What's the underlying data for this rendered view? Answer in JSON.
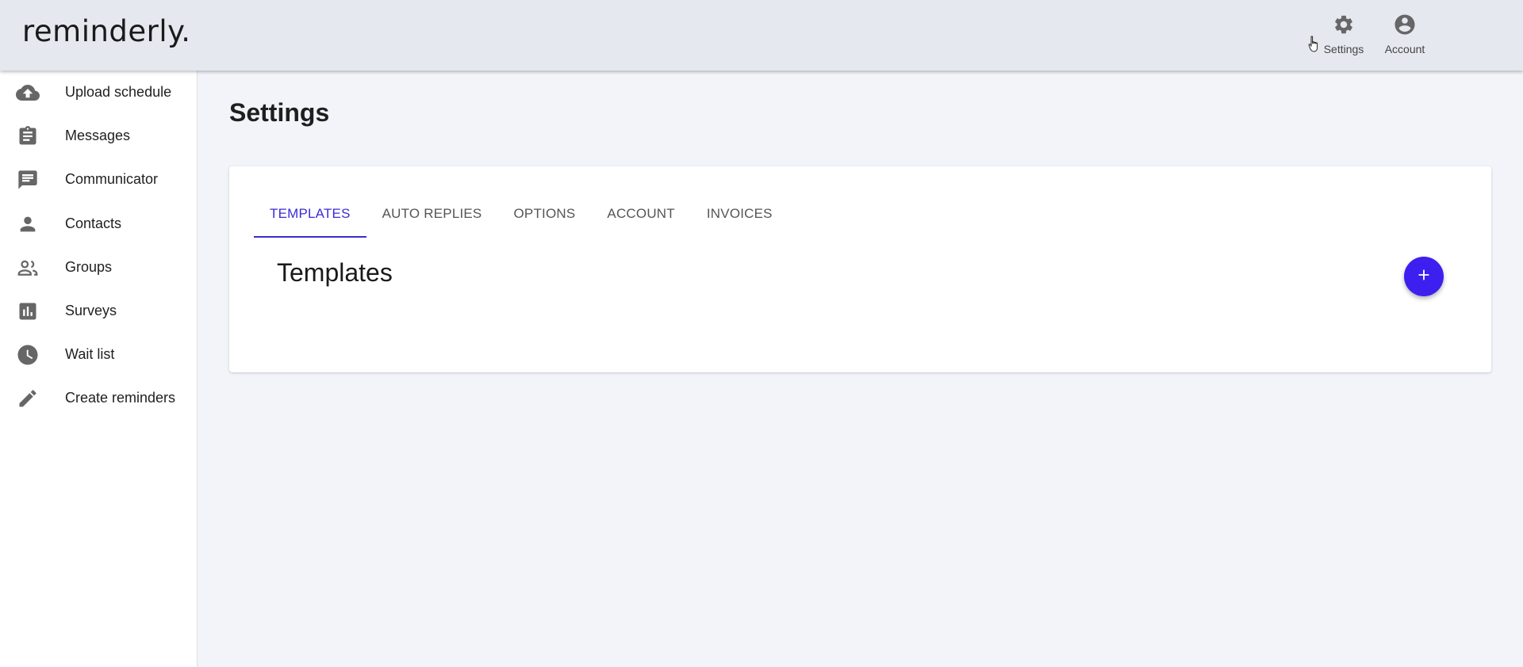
{
  "app": {
    "logo": "reminderly."
  },
  "header": {
    "actions": [
      {
        "label": "Settings",
        "icon": "gear-icon"
      },
      {
        "label": "Account",
        "icon": "account-circle-icon"
      }
    ]
  },
  "sidebar": {
    "items": [
      {
        "label": "Upload schedule",
        "icon": "cloud-upload-icon"
      },
      {
        "label": "Messages",
        "icon": "clipboard-icon"
      },
      {
        "label": "Communicator",
        "icon": "chat-icon"
      },
      {
        "label": "Contacts",
        "icon": "person-icon"
      },
      {
        "label": "Groups",
        "icon": "people-icon"
      },
      {
        "label": "Surveys",
        "icon": "bar-chart-icon"
      },
      {
        "label": "Wait list",
        "icon": "clock-icon"
      },
      {
        "label": "Create reminders",
        "icon": "pencil-icon"
      }
    ]
  },
  "main": {
    "title": "Settings",
    "tabs": [
      {
        "label": "TEMPLATES",
        "active": true
      },
      {
        "label": "AUTO REPLIES",
        "active": false
      },
      {
        "label": "OPTIONS",
        "active": false
      },
      {
        "label": "ACCOUNT",
        "active": false
      },
      {
        "label": "INVOICES",
        "active": false
      }
    ],
    "section_title": "Templates",
    "add_button_icon": "plus-icon"
  },
  "colors": {
    "accent": "#3d2bd6",
    "fab": "#3d1ff0",
    "header_bg": "#e6e8f0",
    "page_bg": "#f3f4f9",
    "icon": "#666666"
  }
}
